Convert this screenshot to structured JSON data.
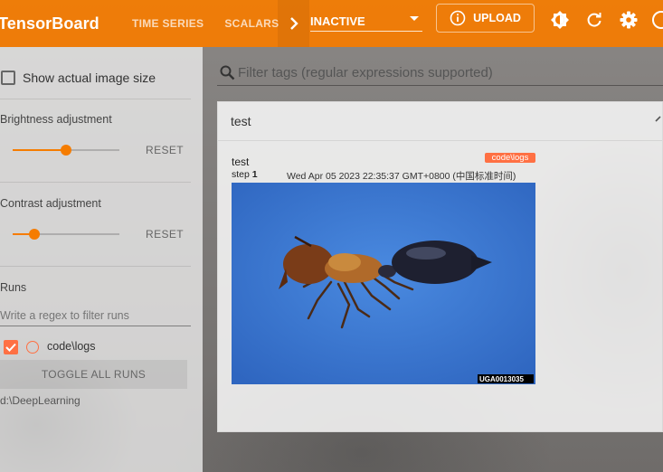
{
  "header": {
    "brand": "TensorBoard",
    "tabs": [
      "TIME SERIES",
      "SCALARS"
    ],
    "dashboard_select": "INACTIVE",
    "upload_label": "UPLOAD",
    "icons": [
      "chevron-right-icon",
      "dropdown-arrow-icon",
      "info-icon",
      "brightness-icon",
      "refresh-icon",
      "settings-icon",
      "help-icon"
    ]
  },
  "sidebar": {
    "show_actual_size_label": "Show actual image size",
    "brightness_label": "Brightness adjustment",
    "brightness_value": 0.5,
    "contrast_label": "Contrast adjustment",
    "contrast_value": 0.2,
    "reset_label": "RESET",
    "runs_title": "Runs",
    "runs_filter_placeholder": "Write a regex to filter runs",
    "runs": [
      {
        "name": "code\\logs",
        "checked": true,
        "color": "#ff7043"
      }
    ],
    "toggle_all_label": "TOGGLE ALL RUNS",
    "logdir": "d:\\DeepLearning"
  },
  "main": {
    "filter_placeholder": "Filter tags (regular expressions supported)",
    "card": {
      "title": "test",
      "image": {
        "tag": "test",
        "run": "code\\logs",
        "step_label": "step",
        "step": "1",
        "timestamp": "Wed Apr 05 2023 22:35:37 GMT+0800 (中国标准时间)",
        "watermark": "UGA0013035"
      }
    }
  },
  "colors": {
    "accent": "#f57c00",
    "run_color": "#ff7043",
    "image_background": "#3a78d2"
  }
}
